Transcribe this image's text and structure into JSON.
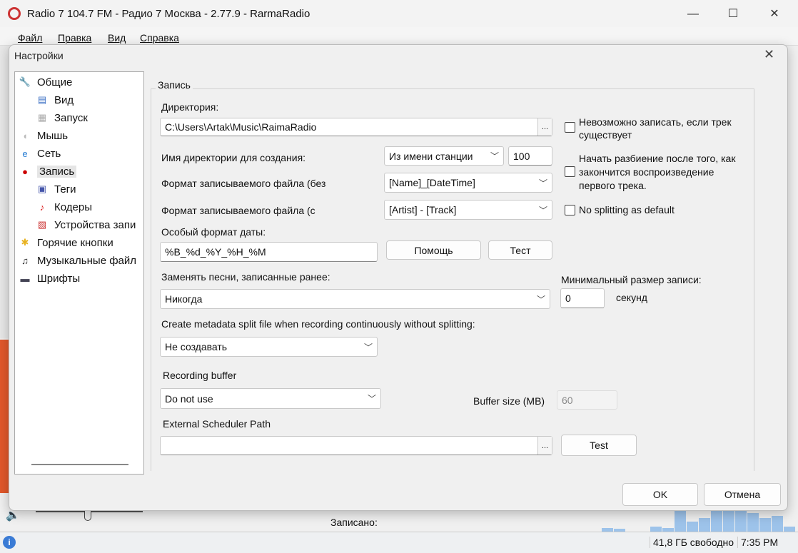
{
  "window": {
    "title": "Radio 7 104.7 FM - Радио 7 Москва - 2.77.9 - RarmaRadio",
    "minimize": "—",
    "maximize": "☐",
    "close": "✕"
  },
  "menu": [
    "Файл",
    "Правка",
    "Вид",
    "Справка"
  ],
  "status": {
    "recorded_label": "Записано:",
    "free_space": "41,8 ГБ свободно",
    "time": "7:35 PM"
  },
  "dialog": {
    "title": "Настройки",
    "close": "✕",
    "ok": "OK",
    "cancel": "Отмена"
  },
  "tree": [
    {
      "label": "Общие",
      "icon": "wrench-icon"
    },
    {
      "label": "Вид",
      "icon": "window-icon"
    },
    {
      "label": "Запуск",
      "icon": "list-icon"
    },
    {
      "label": "Мышь",
      "icon": "mouse-icon"
    },
    {
      "label": "Сеть",
      "icon": "ie-icon"
    },
    {
      "label": "Запись",
      "icon": "record-icon",
      "selected": true
    },
    {
      "label": "Теги",
      "icon": "floppy-icon"
    },
    {
      "label": "Кодеры",
      "icon": "music-icon"
    },
    {
      "label": "Устройства запи",
      "icon": "device-icon"
    },
    {
      "label": "Горячие кнопки",
      "icon": "hotkey-icon"
    },
    {
      "label": "Музыкальные файл",
      "icon": "music-file-icon"
    },
    {
      "label": "Шрифты",
      "icon": "monitor-icon"
    }
  ],
  "record": {
    "group_label": "Запись",
    "directory_label": "Директория:",
    "directory_value": "C:\\Users\\Artak\\Music\\RaimaRadio",
    "browse": "...",
    "cannot_record_label": "Невозможно записать, если трек существует",
    "dir_name_label": "Имя директории для создания:",
    "dir_name_value": "Из имени станции",
    "dir_name_number": "100",
    "start_split_label": "Начать разбиение после того, как закончится воспроизведение первого трека.",
    "format_without_label": "Формат записываемого файла (без",
    "format_without_value": "[Name]_[DateTime]",
    "format_with_label": "Формат записываемого файла (с",
    "format_with_value": "[Artist] - [Track]",
    "no_split_label": "No splitting as default",
    "date_format_label": "Особый формат даты:",
    "date_format_value": "%B_%d_%Y_%H_%M",
    "help_button": "Помощь",
    "test_button": "Тест",
    "replace_label": "Заменять песни, записанные ранее:",
    "replace_value": "Никогда",
    "min_size_label": "Минимальный размер записи:",
    "min_size_value": "0",
    "seconds_label": "секунд",
    "metadata_label": "Create metadata split file when recording continuously without splitting:",
    "metadata_value": "Не создавать",
    "buffer_label": "Recording buffer",
    "buffer_value": "Do not use",
    "buffer_size_label": "Buffer size (MB)",
    "buffer_size_value": "60",
    "scheduler_label": "External Scheduler Path",
    "scheduler_value": "",
    "scheduler_test": "Test"
  },
  "colors": {
    "accent": "#e2582b",
    "spectrum": "#9dc3ea"
  }
}
